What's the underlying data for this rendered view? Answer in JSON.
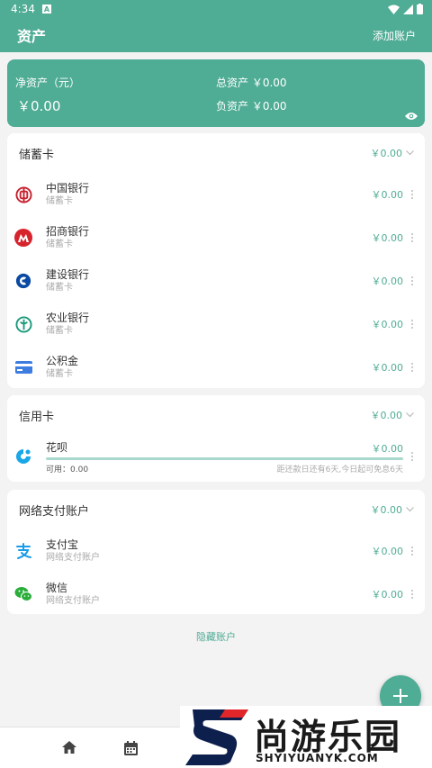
{
  "status_bar": {
    "time": "4:34",
    "badge": "A"
  },
  "app_bar": {
    "title": "资产",
    "action": "添加账户"
  },
  "summary": {
    "net_label": "净资产（元）",
    "net_value": "￥0.00",
    "total": "总资产 ￥0.00",
    "debt": "负资产 ￥0.00"
  },
  "sections": {
    "debit": {
      "title": "储蓄卡",
      "total": "￥0.00",
      "items": [
        {
          "name": "中国银行",
          "type": "储蓄卡",
          "amount": "￥0.00",
          "icon": "bank-of-china-icon"
        },
        {
          "name": "招商银行",
          "type": "储蓄卡",
          "amount": "￥0.00",
          "icon": "cmb-icon"
        },
        {
          "name": "建设银行",
          "type": "储蓄卡",
          "amount": "￥0.00",
          "icon": "ccb-icon"
        },
        {
          "name": "农业银行",
          "type": "储蓄卡",
          "amount": "￥0.00",
          "icon": "abc-icon"
        },
        {
          "name": "公积金",
          "type": "储蓄卡",
          "amount": "￥0.00",
          "icon": "card-icon"
        }
      ]
    },
    "credit": {
      "title": "信用卡",
      "total": "￥0.00",
      "huabei": {
        "name": "花呗",
        "amount": "￥0.00",
        "available": "可用：0.00",
        "note": "距还款日还有6天,今日起可免息6天",
        "used_fraction": 0
      }
    },
    "online": {
      "title": "网络支付账户",
      "total": "￥0.00",
      "items": [
        {
          "name": "支付宝",
          "type": "网络支付账户",
          "amount": "￥0.00",
          "icon": "alipay-icon"
        },
        {
          "name": "微信",
          "type": "网络支付账户",
          "amount": "￥0.00",
          "icon": "wechat-icon"
        }
      ]
    }
  },
  "hide_accounts": "隐藏账户",
  "watermark": {
    "cn": "尚游乐园",
    "en": "SHYIYUANYK.COM"
  },
  "colors": {
    "accent": "#4fac95",
    "background": "#f3f3f3"
  }
}
